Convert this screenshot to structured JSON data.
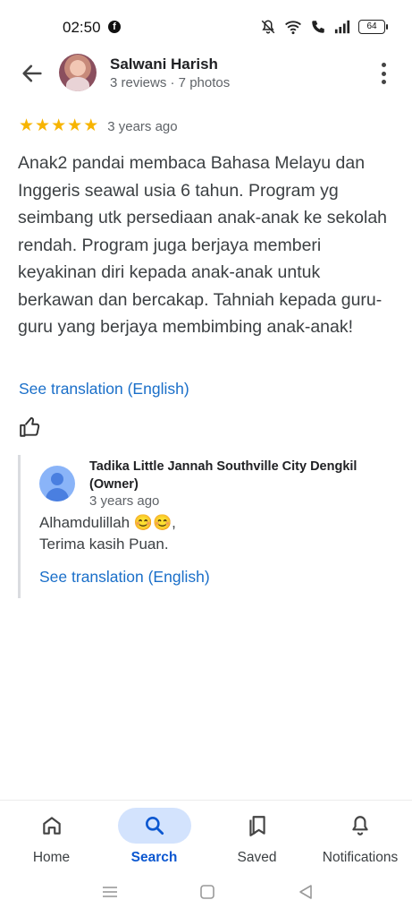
{
  "status_bar": {
    "time": "02:50",
    "battery": "64",
    "icons": [
      "facebook-icon",
      "mute-icon",
      "wifi-icon",
      "wifi-call-icon",
      "signal-icon",
      "battery-icon"
    ]
  },
  "header": {
    "reviewer_name": "Salwani Harish",
    "reviewer_meta": "3 reviews · 7 photos"
  },
  "review": {
    "rating": 5,
    "stars": [
      "★",
      "★",
      "★",
      "★",
      "★"
    ],
    "time_ago": "3 years ago",
    "text": "Anak2 pandai membaca Bahasa Melayu dan Inggeris seawal usia 6 tahun. Program yg seimbang utk persediaan anak-anak ke sekolah rendah. Program juga berjaya memberi keyakinan diri kepada anak-anak untuk berkawan dan bercakap. Tahniah kepada guru-guru yang berjaya membimbing anak-anak!",
    "see_translation": "See translation (English)"
  },
  "owner_reply": {
    "name": "Tadika Little Jannah Southville City Dengkil (Owner)",
    "time_ago": "3 years ago",
    "line1": "Alhamdulillah 😊😊,",
    "line2": "Terima kasih Puan.",
    "see_translation": "See translation (English)"
  },
  "bottom_nav": {
    "items": [
      {
        "label": "Home",
        "icon": "home-icon",
        "active": false
      },
      {
        "label": "Search",
        "icon": "search-icon",
        "active": true
      },
      {
        "label": "Saved",
        "icon": "saved-icon",
        "active": false
      },
      {
        "label": "Notifications",
        "icon": "bell-icon",
        "active": false
      }
    ]
  },
  "colors": {
    "accent": "#1a6fc9",
    "star": "#f7b400",
    "active_nav_bg": "#d3e3fd",
    "active_nav_text": "#0b57d0"
  }
}
